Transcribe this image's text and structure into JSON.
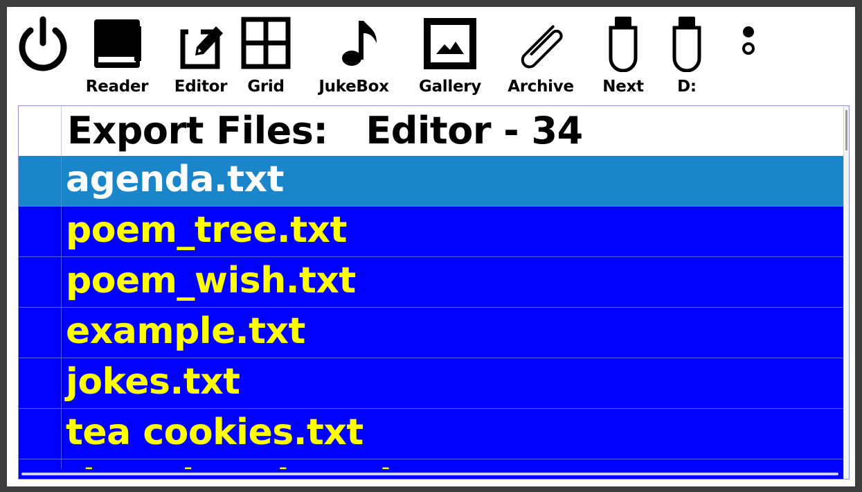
{
  "toolbar": {
    "power": {
      "icon": "power-icon"
    },
    "reader": {
      "label": "Reader",
      "icon": "book-icon"
    },
    "editor": {
      "label": "Editor",
      "icon": "edit-icon"
    },
    "grid": {
      "label": "Grid",
      "icon": "grid-icon"
    },
    "jukebox": {
      "label": "JukeBox",
      "icon": "music-note-icon"
    },
    "gallery": {
      "label": "Gallery",
      "icon": "picture-icon"
    },
    "archive": {
      "label": "Archive",
      "icon": "paperclip-icon"
    },
    "next": {
      "label": "Next",
      "icon": "usb-drive-icon"
    },
    "drive_d": {
      "label": "D:",
      "icon": "usb-drive-icon"
    },
    "more": {
      "icon": "more-dots-icon"
    }
  },
  "list": {
    "title": "Export Files:   Editor - 34",
    "items": [
      {
        "name": "agenda.txt",
        "selected": true
      },
      {
        "name": "poem_tree.txt",
        "selected": false
      },
      {
        "name": "poem_wish.txt",
        "selected": false
      },
      {
        "name": "example.txt",
        "selected": false
      },
      {
        "name": "jokes.txt",
        "selected": false
      },
      {
        "name": "tea cookies.txt",
        "selected": false
      },
      {
        "name": "that chocolate dessert.txt",
        "selected": false
      }
    ]
  },
  "colors": {
    "row_background": "#0000ff",
    "row_text": "#ffff00",
    "selected_background": "#1a85c8",
    "selected_text": "#ffffff",
    "frame": "#3c3c3c"
  }
}
